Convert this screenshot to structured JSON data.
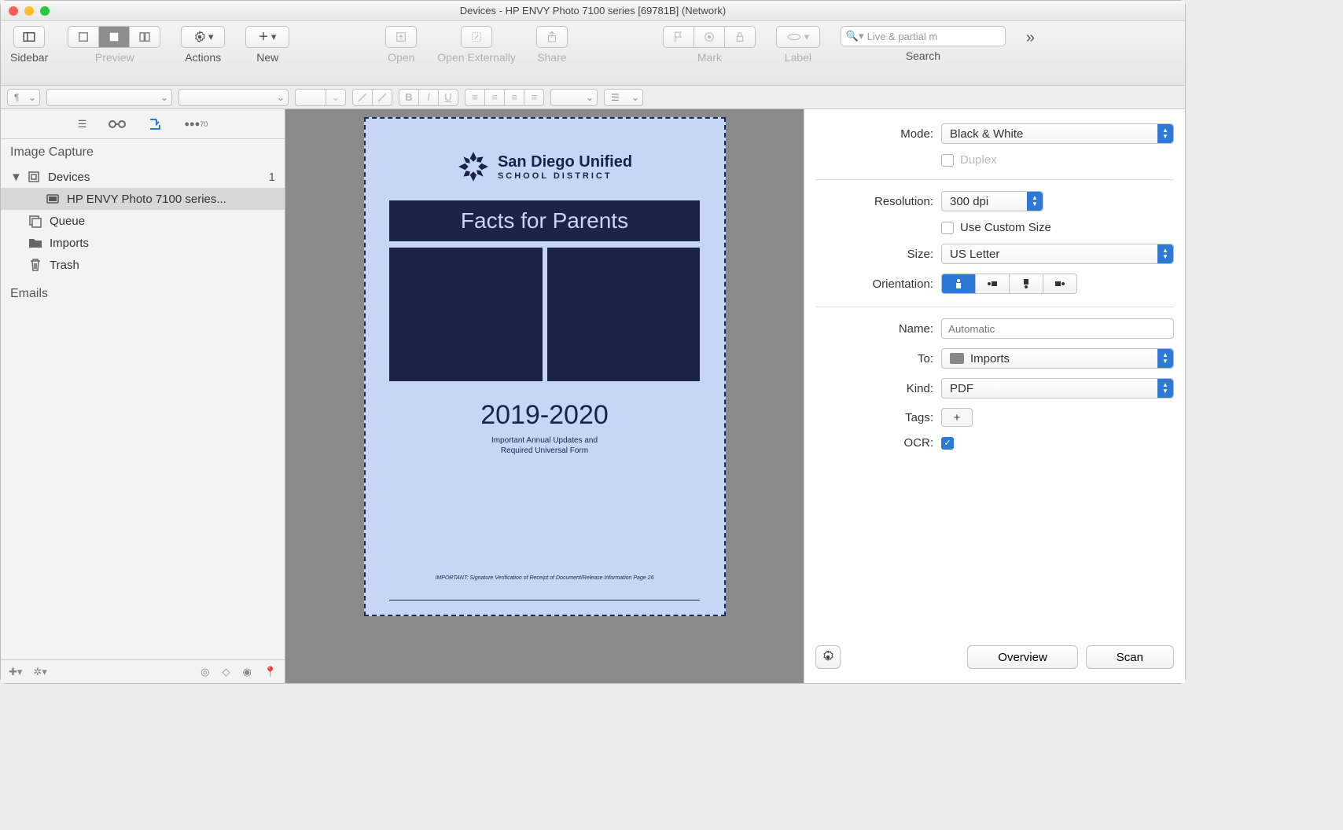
{
  "window": {
    "title": "Devices - HP ENVY Photo 7100 series [69781B] (Network)"
  },
  "toolbar": {
    "sidebar": "Sidebar",
    "preview": "Preview",
    "actions": "Actions",
    "new": "New",
    "open": "Open",
    "open_externally": "Open Externally",
    "share": "Share",
    "mark": "Mark",
    "label": "Label",
    "search_label": "Search",
    "search_placeholder": "Live & partial m"
  },
  "formatbar": {
    "para_marker": "¶"
  },
  "sidebar": {
    "title": "Image Capture",
    "devices_label": "Devices",
    "devices_count": "1",
    "device_item": "HP ENVY Photo 7100 series...",
    "queue": "Queue",
    "imports": "Imports",
    "trash": "Trash",
    "emails": "Emails"
  },
  "preview": {
    "org1": "San Diego Unified",
    "org2": "SCHOOL DISTRICT",
    "banner": "Facts for Parents",
    "year": "2019-2020",
    "sub1": "Important Annual Updates and",
    "sub2": "Required Universal Form",
    "foot": "IMPORTANT: Signature Verification of Receipt of Document/Release Information Page 26"
  },
  "inspector": {
    "mode_label": "Mode:",
    "mode_value": "Black & White",
    "duplex_label": "Duplex",
    "resolution_label": "Resolution:",
    "resolution_value": "300 dpi",
    "custom_size_label": "Use Custom Size",
    "size_label": "Size:",
    "size_value": "US Letter",
    "orientation_label": "Orientation:",
    "name_label": "Name:",
    "name_placeholder": "Automatic",
    "to_label": "To:",
    "to_value": "Imports",
    "kind_label": "Kind:",
    "kind_value": "PDF",
    "tags_label": "Tags:",
    "tags_plus": "+",
    "ocr_label": "OCR:",
    "overview_btn": "Overview",
    "scan_btn": "Scan"
  }
}
